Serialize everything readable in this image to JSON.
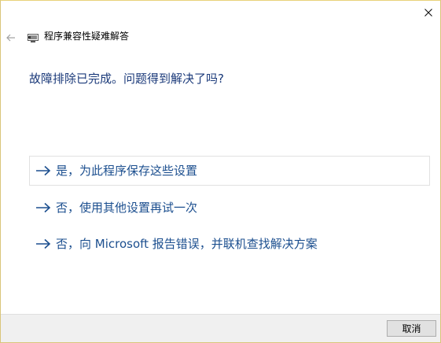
{
  "window": {
    "title": "程序兼容性疑难解答"
  },
  "main": {
    "question": "故障排除已完成。问题得到解决了吗?",
    "options": [
      {
        "label": "是，为此程序保存这些设置"
      },
      {
        "label": "否，使用其他设置再试一次"
      },
      {
        "label": "否，向 Microsoft 报告错误，并联机查找解决方案"
      }
    ]
  },
  "footer": {
    "cancel_label": "取消"
  },
  "colors": {
    "link": "#1c4f8f",
    "heading": "#1b3a7a",
    "footer_bg": "#f0f0f0",
    "window_border": "#d9c57a"
  },
  "icons": {
    "close": "close-icon",
    "back": "back-arrow-icon",
    "app": "troubleshooter-icon",
    "option_arrow": "arrow-right-icon"
  }
}
